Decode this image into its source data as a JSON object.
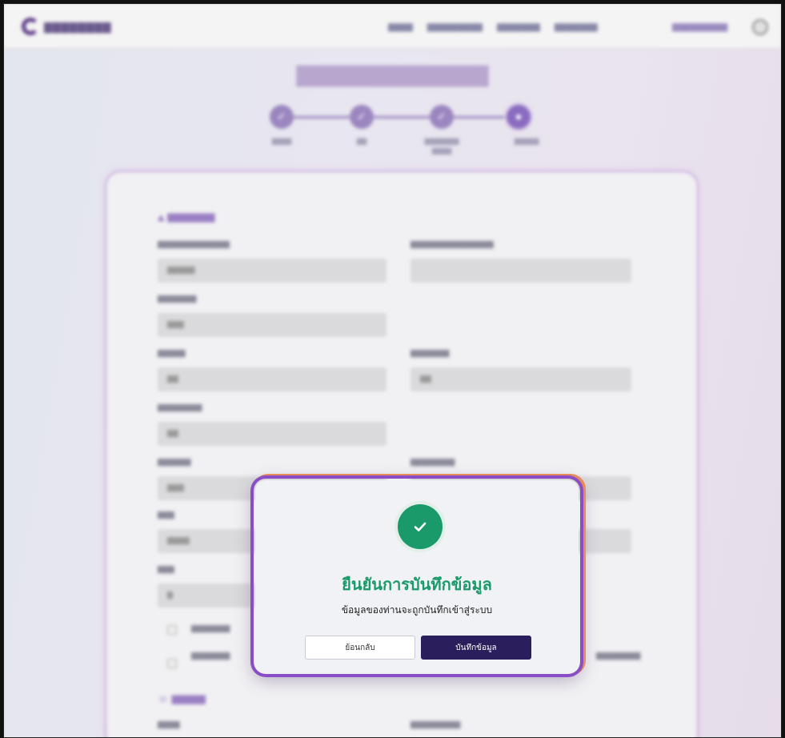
{
  "modal": {
    "title": "ยืนยันการบันทึกข้อมูล",
    "message": "ข้อมูลของท่านจะถูกบันทึกเข้าสู่ระบบ",
    "back_label": "ย้อนกลับ",
    "save_label": "บันทึกข้อมูล",
    "success_color": "#1a9a6a",
    "primary_color": "#2a1f5c"
  },
  "icons": {
    "success": "check-circle-icon",
    "logo": "logo-mark-icon",
    "avatar": "user-avatar-icon"
  },
  "theme": {
    "accent": "#8a6bbf"
  }
}
